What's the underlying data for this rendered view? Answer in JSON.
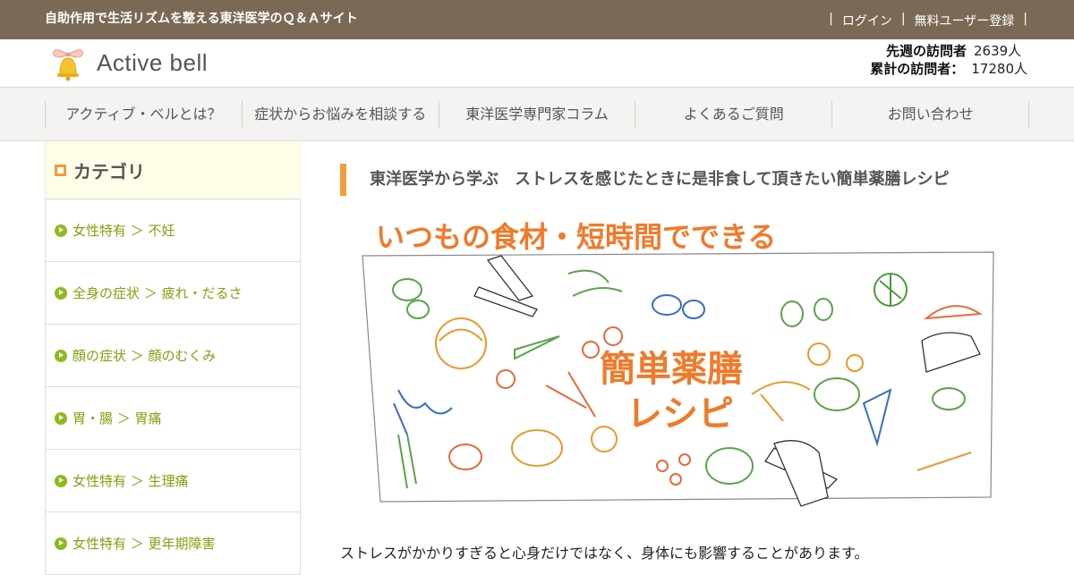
{
  "topbar": {
    "tagline": "自助作用で生活リズムを整える東洋医学のＱ＆Ａサイト",
    "sep": "|",
    "login": "ログイン",
    "register": "無料ユーザー登録"
  },
  "header": {
    "logo_text": "Active bell",
    "visitors": {
      "last_week_label": "先週の訪問者",
      "last_week_value": "2639人",
      "total_label": "累計の訪問者：",
      "total_value": "17280人"
    }
  },
  "nav": {
    "items": [
      {
        "label": "アクティブ・ベルとは？"
      },
      {
        "label": "症状からお悩みを相談する"
      },
      {
        "label": "東洋医学専門家コラム"
      },
      {
        "label": "よくあるご質問"
      },
      {
        "label": "お問い合わせ"
      }
    ]
  },
  "sidebar": {
    "heading": "カテゴリ",
    "categories": [
      {
        "label": "女性特有 ＞ 不妊"
      },
      {
        "label": "全身の症状 ＞ 疲れ・だるさ"
      },
      {
        "label": "顔の症状 ＞ 顔のむくみ"
      },
      {
        "label": "胃・腸 ＞ 胃痛"
      },
      {
        "label": "女性特有 ＞ 生理痛"
      },
      {
        "label": "女性特有 ＞ 更年期障害"
      }
    ]
  },
  "main": {
    "title": "東洋医学から学ぶ　ストレスを感じたときに是非食して頂きたい簡単薬膳レシピ",
    "hero": {
      "headline": "いつもの食材・短時間でできる",
      "center_line1": "簡単薬膳",
      "center_line2": "レシピ"
    },
    "body": "ストレスがかかりすぎると心身だけではなく、身体にも影響することがあります。"
  },
  "colors": {
    "topbar_bg": "#7a6a55",
    "accent_orange": "#f39c3b",
    "category_green": "#7ea20f",
    "hero_text_orange": "#f07a2a"
  }
}
